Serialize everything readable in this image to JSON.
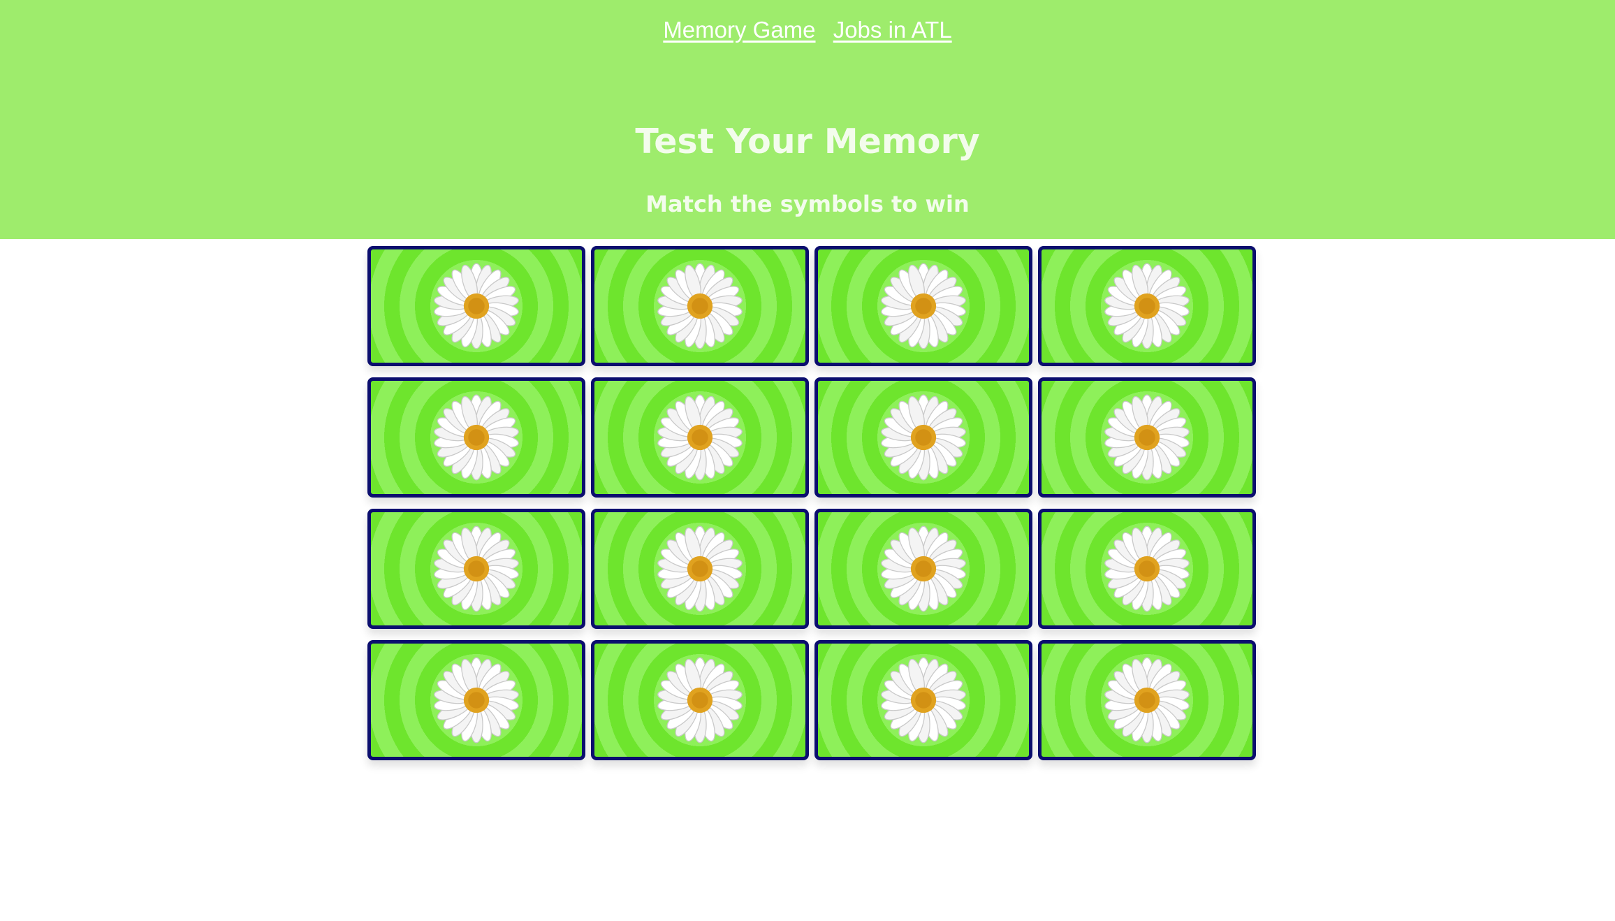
{
  "nav": {
    "links": [
      {
        "label": "Memory Game"
      },
      {
        "label": "Jobs in ATL"
      }
    ]
  },
  "header": {
    "title": "Test Your Memory",
    "subtitle": "Match the symbols to win"
  },
  "colors": {
    "header_bg": "#9eec6c",
    "header_text": "#f3fcec",
    "card_border": "#0b0e6e",
    "card_ring_light": "#8ef05a",
    "card_ring_dark": "#6ee52d"
  },
  "board": {
    "rows": 4,
    "columns": 4,
    "cards": [
      {
        "face": "face-down",
        "back_icon": "daisy-icon"
      },
      {
        "face": "face-down",
        "back_icon": "daisy-icon"
      },
      {
        "face": "face-down",
        "back_icon": "daisy-icon"
      },
      {
        "face": "face-down",
        "back_icon": "daisy-icon"
      },
      {
        "face": "face-down",
        "back_icon": "daisy-icon"
      },
      {
        "face": "face-down",
        "back_icon": "daisy-icon"
      },
      {
        "face": "face-down",
        "back_icon": "daisy-icon"
      },
      {
        "face": "face-down",
        "back_icon": "daisy-icon"
      },
      {
        "face": "face-down",
        "back_icon": "daisy-icon"
      },
      {
        "face": "face-down",
        "back_icon": "daisy-icon"
      },
      {
        "face": "face-down",
        "back_icon": "daisy-icon"
      },
      {
        "face": "face-down",
        "back_icon": "daisy-icon"
      },
      {
        "face": "face-down",
        "back_icon": "daisy-icon"
      },
      {
        "face": "face-down",
        "back_icon": "daisy-icon"
      },
      {
        "face": "face-down",
        "back_icon": "daisy-icon"
      },
      {
        "face": "face-down",
        "back_icon": "daisy-icon"
      }
    ]
  }
}
